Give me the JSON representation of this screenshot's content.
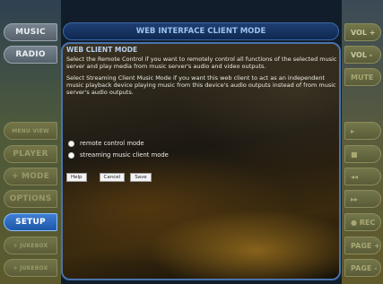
{
  "left_nav": {
    "music": "MUSIC",
    "radio": "RADIO",
    "menu_view": "MENU VIEW",
    "player": "PLAYER",
    "mode": "+ MODE",
    "options": "OPTIONS",
    "setup": "SETUP",
    "jukebox_1": "+ JUKEBOX",
    "jukebox_2": "+ JUKEBOX"
  },
  "right_nav": {
    "vol_up": "VOL +",
    "vol_down": "VOL -",
    "mute": "MUTE",
    "play": "▸",
    "stop": "■",
    "rewind": "◂◂",
    "forward": "▸▸",
    "rec": "● REC",
    "page_up": "PAGE +",
    "page_down": "PAGE -"
  },
  "header": {
    "title": "WEB INTERFACE CLIENT MODE"
  },
  "panel": {
    "section_title": "WEB CLIENT MODE",
    "para1": "Select the Remote Control if you want to remotely control all functions of the selected music server and play media from music server's audio and video outputs.",
    "para2": "Select Streaming Client Music Mode if you want this web client to act as an independent music playback device playing music from this device's audio outputs instead of from music server's audio outputs.",
    "options": [
      {
        "label": "remote control mode",
        "selected": false
      },
      {
        "label": "streaming music client mode",
        "selected": true
      }
    ],
    "buttons": {
      "help": "Help",
      "cancel": "Cancel",
      "save": "Save"
    }
  },
  "colors": {
    "active_nav": "#2a6cc4",
    "title_text": "#9cc2ef",
    "panel_border": "#4a73ac"
  }
}
